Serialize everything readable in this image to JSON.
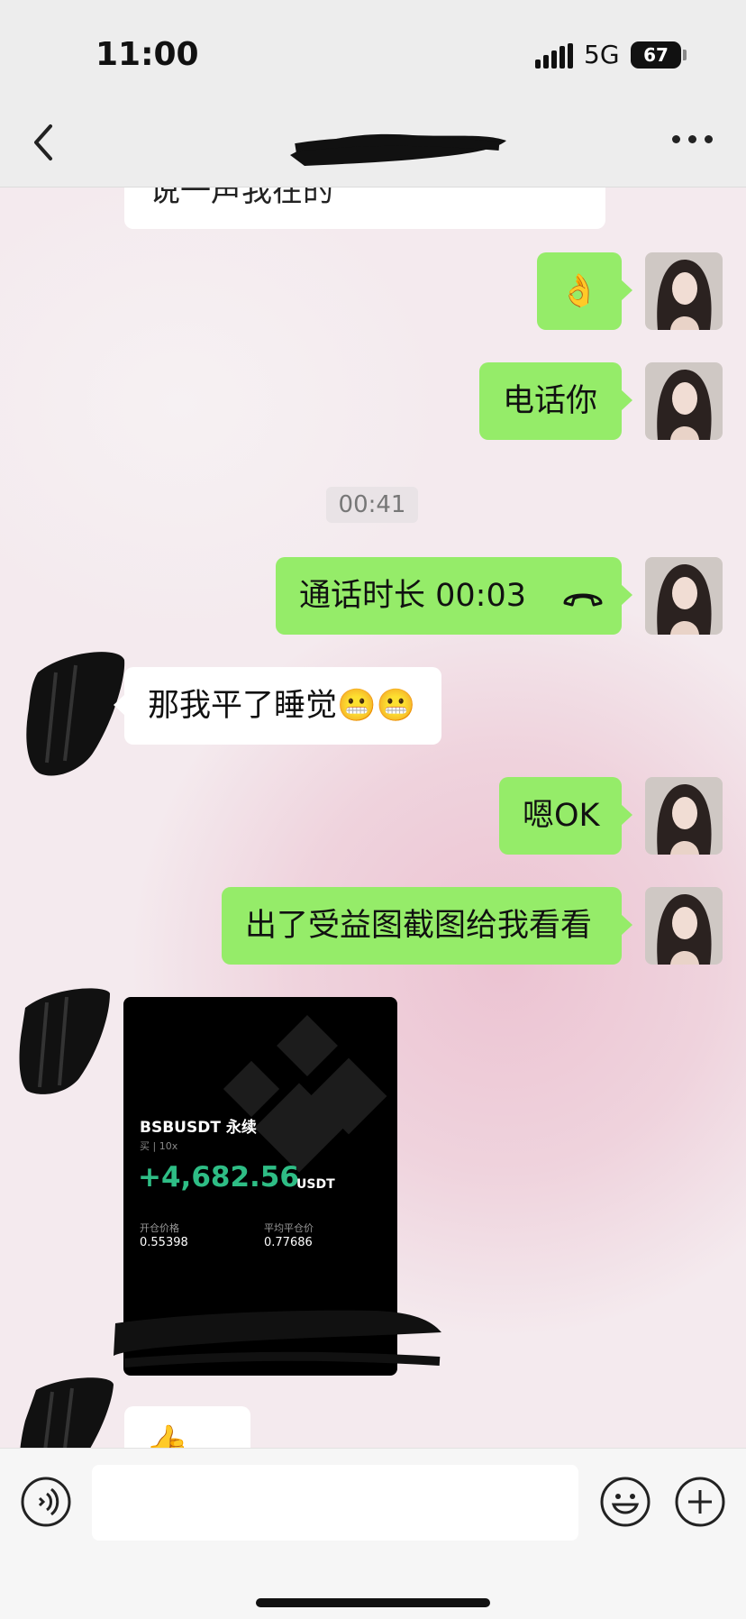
{
  "status_bar": {
    "time": "11:00",
    "network": "5G",
    "battery": "67"
  },
  "nav": {
    "title": ""
  },
  "messages": {
    "partial_top": "说一声我在的",
    "ok_emoji": "👌",
    "call_you": "电话你",
    "timestamp": "00:41",
    "call_duration": "通话时长 00:03",
    "sleep": "那我平了睡觉😬😬",
    "ok": "嗯OK",
    "screenshot_request": "出了受益图截图给我看看",
    "thumbs": "👍👍"
  },
  "trade_card": {
    "symbol": "BSBUSDT 永续",
    "side": "买",
    "leverage": "10x",
    "pnl": "+4,682.56",
    "unit": "USDT",
    "entry_label": "开仓价格",
    "entry_value": "0.55398",
    "exit_label": "平均平仓价",
    "exit_value": "0.77686"
  },
  "input": {
    "placeholder": ""
  }
}
